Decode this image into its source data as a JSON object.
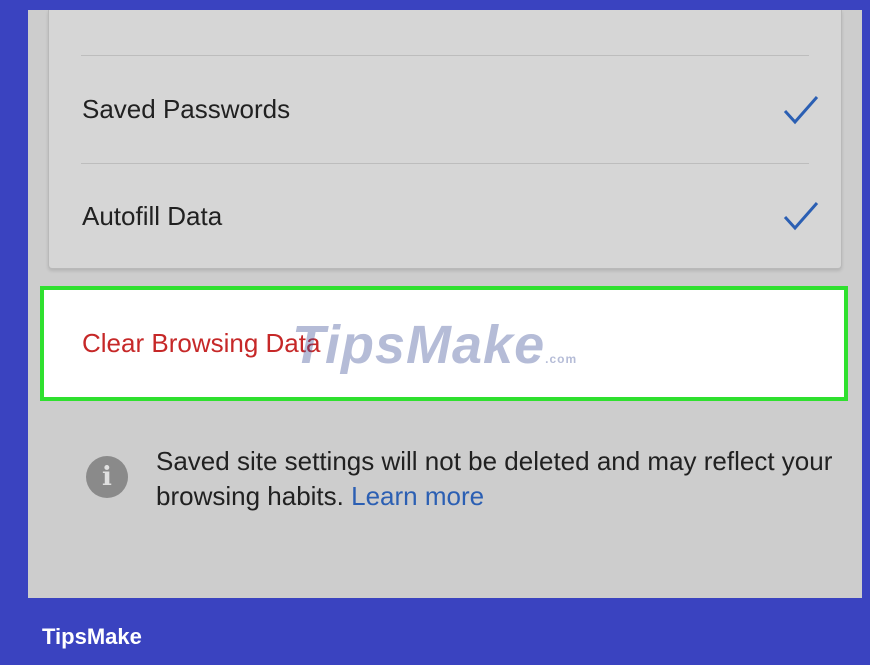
{
  "settings": {
    "items": [
      {
        "label": "Saved Passwords",
        "checked": true
      },
      {
        "label": "Autofill Data",
        "checked": true
      }
    ],
    "clear_button_label": "Clear Browsing Data",
    "info_text": "Saved site settings will not be deleted and may reflect your browsing habits.",
    "learn_more": "Learn more"
  },
  "watermark": {
    "text": "TipsMake",
    "suffix": ".com"
  },
  "brand": "TipsMake",
  "colors": {
    "frame": "#3a43c0",
    "highlight_border": "#2fe02f",
    "check": "#2b5fb3",
    "clear_text": "#c62828",
    "link": "#2b5fb3"
  }
}
